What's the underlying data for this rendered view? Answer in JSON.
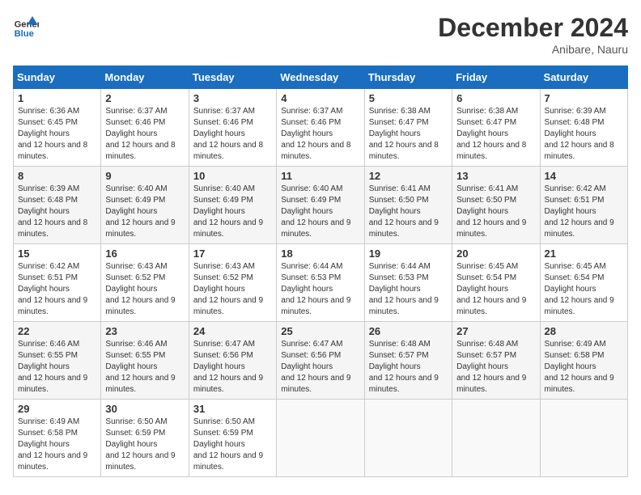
{
  "logo": {
    "line1": "General",
    "line2": "Blue"
  },
  "title": "December 2024",
  "location": "Anibare, Nauru",
  "days_header": [
    "Sunday",
    "Monday",
    "Tuesday",
    "Wednesday",
    "Thursday",
    "Friday",
    "Saturday"
  ],
  "weeks": [
    [
      {
        "day": "1",
        "sunrise": "6:36 AM",
        "sunset": "6:45 PM",
        "daylight": "12 hours and 8 minutes."
      },
      {
        "day": "2",
        "sunrise": "6:37 AM",
        "sunset": "6:46 PM",
        "daylight": "12 hours and 8 minutes."
      },
      {
        "day": "3",
        "sunrise": "6:37 AM",
        "sunset": "6:46 PM",
        "daylight": "12 hours and 8 minutes."
      },
      {
        "day": "4",
        "sunrise": "6:37 AM",
        "sunset": "6:46 PM",
        "daylight": "12 hours and 8 minutes."
      },
      {
        "day": "5",
        "sunrise": "6:38 AM",
        "sunset": "6:47 PM",
        "daylight": "12 hours and 8 minutes."
      },
      {
        "day": "6",
        "sunrise": "6:38 AM",
        "sunset": "6:47 PM",
        "daylight": "12 hours and 8 minutes."
      },
      {
        "day": "7",
        "sunrise": "6:39 AM",
        "sunset": "6:48 PM",
        "daylight": "12 hours and 8 minutes."
      }
    ],
    [
      {
        "day": "8",
        "sunrise": "6:39 AM",
        "sunset": "6:48 PM",
        "daylight": "12 hours and 8 minutes."
      },
      {
        "day": "9",
        "sunrise": "6:40 AM",
        "sunset": "6:49 PM",
        "daylight": "12 hours and 9 minutes."
      },
      {
        "day": "10",
        "sunrise": "6:40 AM",
        "sunset": "6:49 PM",
        "daylight": "12 hours and 9 minutes."
      },
      {
        "day": "11",
        "sunrise": "6:40 AM",
        "sunset": "6:49 PM",
        "daylight": "12 hours and 9 minutes."
      },
      {
        "day": "12",
        "sunrise": "6:41 AM",
        "sunset": "6:50 PM",
        "daylight": "12 hours and 9 minutes."
      },
      {
        "day": "13",
        "sunrise": "6:41 AM",
        "sunset": "6:50 PM",
        "daylight": "12 hours and 9 minutes."
      },
      {
        "day": "14",
        "sunrise": "6:42 AM",
        "sunset": "6:51 PM",
        "daylight": "12 hours and 9 minutes."
      }
    ],
    [
      {
        "day": "15",
        "sunrise": "6:42 AM",
        "sunset": "6:51 PM",
        "daylight": "12 hours and 9 minutes."
      },
      {
        "day": "16",
        "sunrise": "6:43 AM",
        "sunset": "6:52 PM",
        "daylight": "12 hours and 9 minutes."
      },
      {
        "day": "17",
        "sunrise": "6:43 AM",
        "sunset": "6:52 PM",
        "daylight": "12 hours and 9 minutes."
      },
      {
        "day": "18",
        "sunrise": "6:44 AM",
        "sunset": "6:53 PM",
        "daylight": "12 hours and 9 minutes."
      },
      {
        "day": "19",
        "sunrise": "6:44 AM",
        "sunset": "6:53 PM",
        "daylight": "12 hours and 9 minutes."
      },
      {
        "day": "20",
        "sunrise": "6:45 AM",
        "sunset": "6:54 PM",
        "daylight": "12 hours and 9 minutes."
      },
      {
        "day": "21",
        "sunrise": "6:45 AM",
        "sunset": "6:54 PM",
        "daylight": "12 hours and 9 minutes."
      }
    ],
    [
      {
        "day": "22",
        "sunrise": "6:46 AM",
        "sunset": "6:55 PM",
        "daylight": "12 hours and 9 minutes."
      },
      {
        "day": "23",
        "sunrise": "6:46 AM",
        "sunset": "6:55 PM",
        "daylight": "12 hours and 9 minutes."
      },
      {
        "day": "24",
        "sunrise": "6:47 AM",
        "sunset": "6:56 PM",
        "daylight": "12 hours and 9 minutes."
      },
      {
        "day": "25",
        "sunrise": "6:47 AM",
        "sunset": "6:56 PM",
        "daylight": "12 hours and 9 minutes."
      },
      {
        "day": "26",
        "sunrise": "6:48 AM",
        "sunset": "6:57 PM",
        "daylight": "12 hours and 9 minutes."
      },
      {
        "day": "27",
        "sunrise": "6:48 AM",
        "sunset": "6:57 PM",
        "daylight": "12 hours and 9 minutes."
      },
      {
        "day": "28",
        "sunrise": "6:49 AM",
        "sunset": "6:58 PM",
        "daylight": "12 hours and 9 minutes."
      }
    ],
    [
      {
        "day": "29",
        "sunrise": "6:49 AM",
        "sunset": "6:58 PM",
        "daylight": "12 hours and 9 minutes."
      },
      {
        "day": "30",
        "sunrise": "6:50 AM",
        "sunset": "6:59 PM",
        "daylight": "12 hours and 9 minutes."
      },
      {
        "day": "31",
        "sunrise": "6:50 AM",
        "sunset": "6:59 PM",
        "daylight": "12 hours and 9 minutes."
      },
      null,
      null,
      null,
      null
    ]
  ]
}
